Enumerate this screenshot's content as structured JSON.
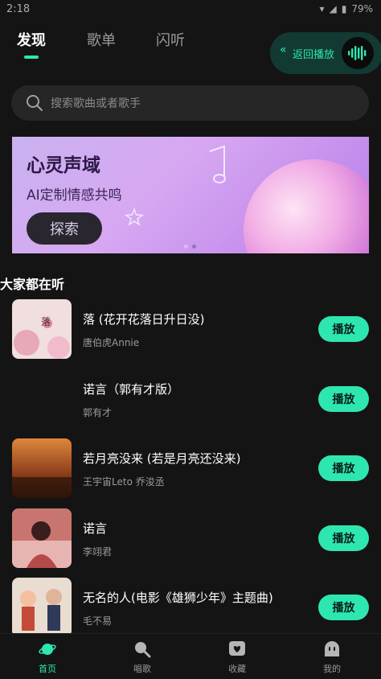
{
  "status_bar": {
    "time": "2:18",
    "battery": "79%"
  },
  "tabs": [
    {
      "label": "发现",
      "active": true
    },
    {
      "label": "歌单",
      "active": false
    },
    {
      "label": "闪听",
      "active": false
    }
  ],
  "return_playback": {
    "label": "返回播放",
    "icon": "chevron-double-left-icon"
  },
  "search": {
    "placeholder": "搜索歌曲或者歌手"
  },
  "banner": {
    "title": "心灵声域",
    "subtitle": "AI定制情感共鸣",
    "cta_label": "探索"
  },
  "section": {
    "title": "大家都在听"
  },
  "songs": [
    {
      "title": "落 (花开花落日升日没)",
      "artist": "唐伯虎Annie",
      "play_label": "播放"
    },
    {
      "title": "诺言（郭有才版）",
      "artist": "郭有才",
      "play_label": "播放"
    },
    {
      "title": "若月亮没来 (若是月亮还没来)",
      "artist": "王宇宙Leto 乔浚丞",
      "play_label": "播放"
    },
    {
      "title": "诺言",
      "artist": "李翊君",
      "play_label": "播放"
    },
    {
      "title": "无名的人(电影《雄狮少年》主题曲)",
      "artist": "毛不易",
      "play_label": "播放"
    }
  ],
  "bottom_nav": [
    {
      "label": "首页",
      "icon": "planet-icon",
      "active": true
    },
    {
      "label": "唱歌",
      "icon": "microphone-icon",
      "active": false
    },
    {
      "label": "收藏",
      "icon": "heart-icon",
      "active": false
    },
    {
      "label": "我的",
      "icon": "ghost-icon",
      "active": false
    }
  ],
  "colors": {
    "accent": "#2ee7b0",
    "background": "#141414",
    "search_bg": "#262626"
  }
}
